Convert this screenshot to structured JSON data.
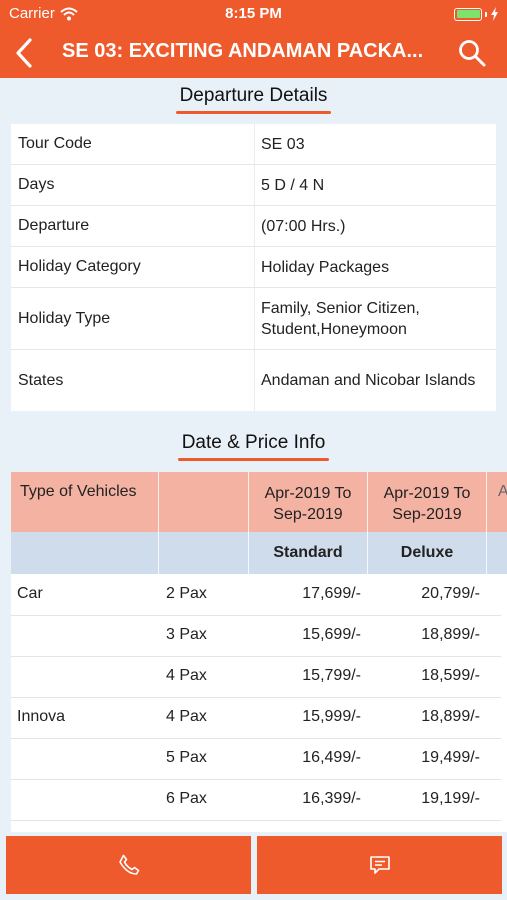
{
  "status_bar": {
    "carrier": "Carrier",
    "time": "8:15 PM"
  },
  "header": {
    "title": "SE 03: EXCITING ANDAMAN PACKA..."
  },
  "departure": {
    "heading": "Departure Details",
    "rows": [
      {
        "key": "Tour Code",
        "value": "SE 03"
      },
      {
        "key": "Days",
        "value": "5 D / 4 N"
      },
      {
        "key": "Departure",
        "value": "(07:00 Hrs.)"
      },
      {
        "key": "Holiday Category",
        "value": "Holiday Packages"
      },
      {
        "key": "Holiday Type",
        "value": "Family, Senior Citizen, Student,Honeymoon"
      },
      {
        "key": "States",
        "value": "Andaman and Nicobar Islands"
      }
    ]
  },
  "price_info": {
    "heading": "Date & Price Info",
    "col_vehicle": "Type of Vehicles",
    "periods": [
      "Apr-2019 To Sep-2019",
      "Apr-2019 To Sep-2019",
      "A"
    ],
    "classes": [
      "Standard",
      "Deluxe"
    ],
    "rows": [
      {
        "vehicle": "Car",
        "pax": "2 Pax",
        "standard": "17,699/-",
        "deluxe": "20,799/-"
      },
      {
        "vehicle": "",
        "pax": "3 Pax",
        "standard": "15,699/-",
        "deluxe": "18,899/-"
      },
      {
        "vehicle": "",
        "pax": "4 Pax",
        "standard": "15,799/-",
        "deluxe": "18,599/-"
      },
      {
        "vehicle": "Innova",
        "pax": "4 Pax",
        "standard": "15,999/-",
        "deluxe": "18,899/-"
      },
      {
        "vehicle": "",
        "pax": "5 Pax",
        "standard": "16,499/-",
        "deluxe": "19,499/-"
      },
      {
        "vehicle": "",
        "pax": "6 Pax",
        "standard": "16,399/-",
        "deluxe": "19,199/-"
      }
    ]
  },
  "icons": {
    "wifi": "wifi-icon",
    "battery": "battery-icon",
    "back": "back-chevron-icon",
    "search": "search-icon",
    "phone": "phone-icon",
    "message": "message-icon"
  },
  "colors": {
    "accent": "#ee5a2b",
    "price_header": "#f4b2a3",
    "class_header": "#cfdceb",
    "background": "#e8f1f7"
  }
}
